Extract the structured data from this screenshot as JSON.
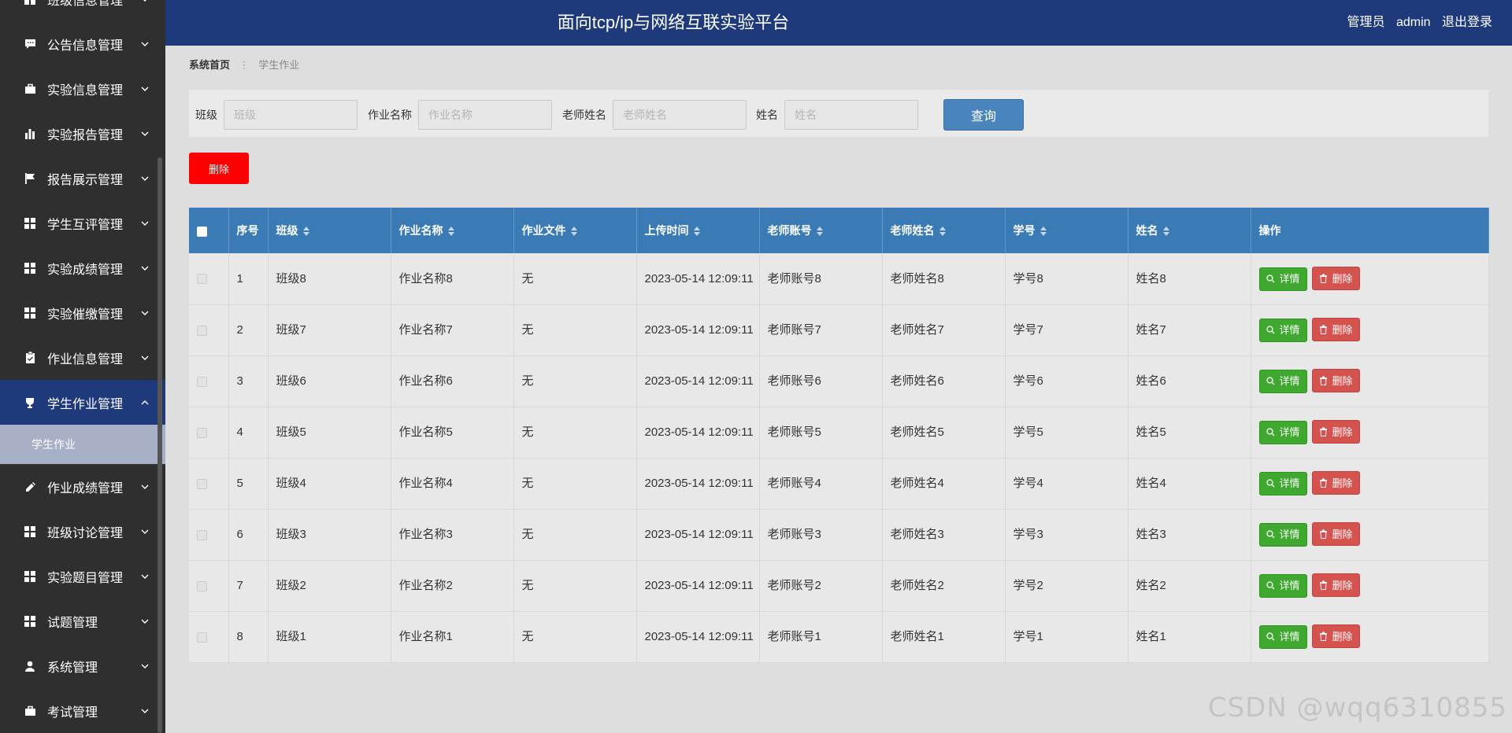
{
  "sidebar": {
    "items": [
      {
        "label": "班级信息管理",
        "icon": "grid-icon"
      },
      {
        "label": "公告信息管理",
        "icon": "comment-icon"
      },
      {
        "label": "实验信息管理",
        "icon": "briefcase-icon"
      },
      {
        "label": "实验报告管理",
        "icon": "bar-chart-icon"
      },
      {
        "label": "报告展示管理",
        "icon": "flag-icon"
      },
      {
        "label": "学生互评管理",
        "icon": "grid-icon"
      },
      {
        "label": "实验成绩管理",
        "icon": "grid-icon"
      },
      {
        "label": "实验催缴管理",
        "icon": "grid-icon"
      },
      {
        "label": "作业信息管理",
        "icon": "clipboard-icon"
      },
      {
        "label": "学生作业管理",
        "icon": "trophy-icon",
        "active": true,
        "subitems": [
          {
            "label": "学生作业"
          }
        ]
      },
      {
        "label": "作业成绩管理",
        "icon": "pencil-icon"
      },
      {
        "label": "班级讨论管理",
        "icon": "grid-icon"
      },
      {
        "label": "实验题目管理",
        "icon": "grid-icon"
      },
      {
        "label": "试题管理",
        "icon": "grid-icon"
      },
      {
        "label": "系统管理",
        "icon": "user-icon"
      },
      {
        "label": "考试管理",
        "icon": "briefcase-icon"
      }
    ]
  },
  "header": {
    "title": "面向tcp/ip与网络互联实验平台",
    "user_role": "管理员",
    "username": "admin",
    "logout": "退出登录"
  },
  "breadcrumb": {
    "home": "系统首页",
    "separator": "⋮",
    "current": "学生作业"
  },
  "search": {
    "fields": [
      {
        "label": "班级",
        "placeholder": "班级"
      },
      {
        "label": "作业名称",
        "placeholder": "作业名称"
      },
      {
        "label": "老师姓名",
        "placeholder": "老师姓名"
      },
      {
        "label": "姓名",
        "placeholder": "姓名"
      }
    ],
    "button": "查询"
  },
  "toolbar": {
    "delete_label": "删除"
  },
  "table": {
    "columns": [
      "序号",
      "班级",
      "作业名称",
      "作业文件",
      "上传时间",
      "老师账号",
      "老师姓名",
      "学号",
      "姓名",
      "操作"
    ],
    "actions": {
      "detail": "详情",
      "delete": "删除"
    },
    "rows": [
      [
        "1",
        "班级8",
        "作业名称8",
        "无",
        "2023-05-14 12:09:11",
        "老师账号8",
        "老师姓名8",
        "学号8",
        "姓名8"
      ],
      [
        "2",
        "班级7",
        "作业名称7",
        "无",
        "2023-05-14 12:09:11",
        "老师账号7",
        "老师姓名7",
        "学号7",
        "姓名7"
      ],
      [
        "3",
        "班级6",
        "作业名称6",
        "无",
        "2023-05-14 12:09:11",
        "老师账号6",
        "老师姓名6",
        "学号6",
        "姓名6"
      ],
      [
        "4",
        "班级5",
        "作业名称5",
        "无",
        "2023-05-14 12:09:11",
        "老师账号5",
        "老师姓名5",
        "学号5",
        "姓名5"
      ],
      [
        "5",
        "班级4",
        "作业名称4",
        "无",
        "2023-05-14 12:09:11",
        "老师账号4",
        "老师姓名4",
        "学号4",
        "姓名4"
      ],
      [
        "6",
        "班级3",
        "作业名称3",
        "无",
        "2023-05-14 12:09:11",
        "老师账号3",
        "老师姓名3",
        "学号3",
        "姓名3"
      ],
      [
        "7",
        "班级2",
        "作业名称2",
        "无",
        "2023-05-14 12:09:11",
        "老师账号2",
        "老师姓名2",
        "学号2",
        "姓名2"
      ],
      [
        "8",
        "班级1",
        "作业名称1",
        "无",
        "2023-05-14 12:09:11",
        "老师账号1",
        "老师姓名1",
        "学号1",
        "姓名1"
      ]
    ]
  },
  "watermark": "CSDN @wqq6310855",
  "colors": {
    "header_bg": "#1f3a7a",
    "table_header": "#3b7bb5",
    "detail_btn": "#3fa82f",
    "delete_btn": "#d5534f",
    "bulk_delete": "#ff0000"
  }
}
